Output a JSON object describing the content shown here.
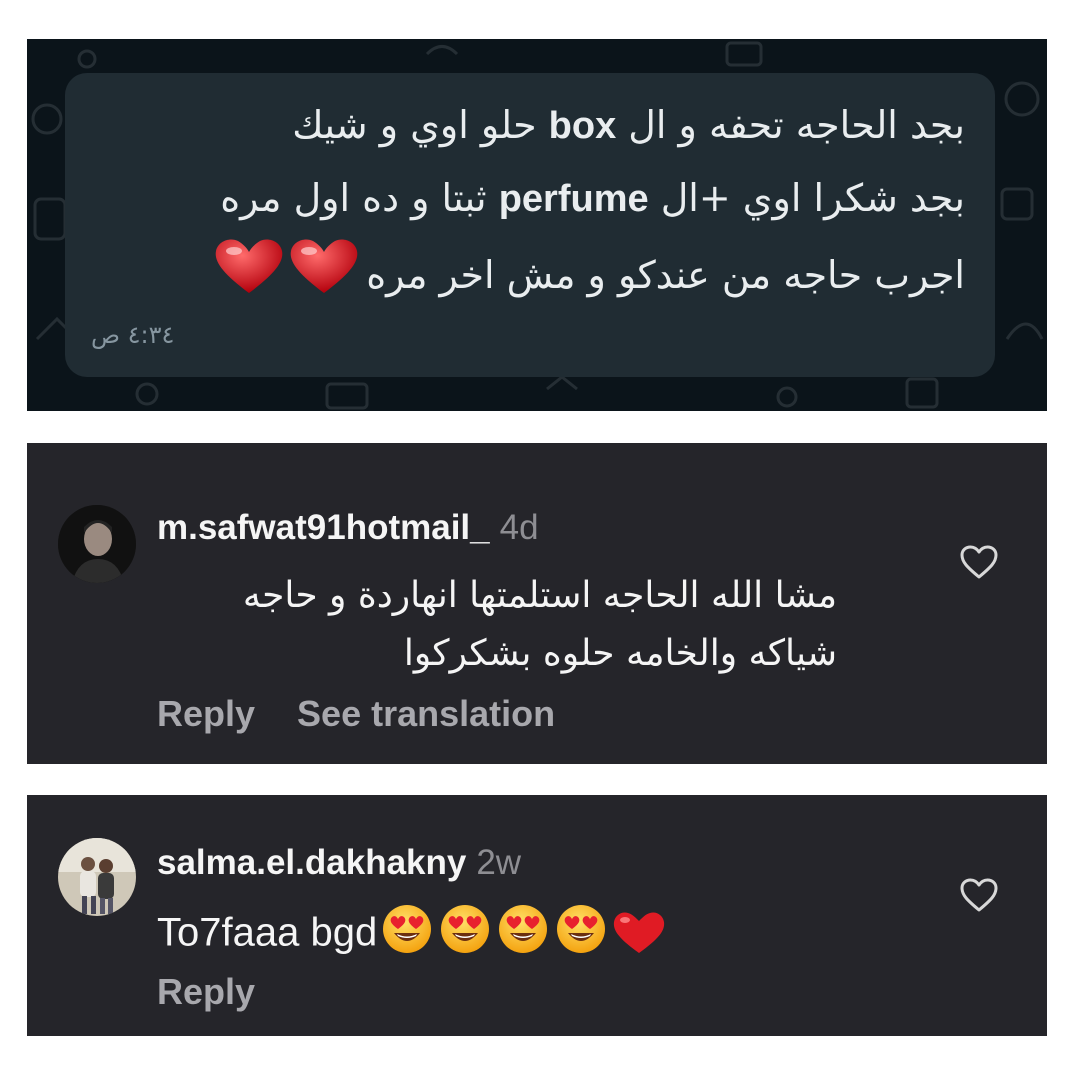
{
  "whatsapp": {
    "message_lines": [
      {
        "pre": "بجد الحاجه تحفه و ال ",
        "latin": "box",
        "post": " حلو اوي و شيك"
      },
      {
        "pre": "بجد شكرا اوي +ال ",
        "latin": "perfume",
        "post": " ثبتا و ده اول مره"
      },
      {
        "pre": "اجرب حاجه من عندكو و مش اخر مره",
        "latin": "",
        "post": ""
      }
    ],
    "heart_emojis": [
      "heart",
      "heart"
    ],
    "time": "٤:٣٤ ص"
  },
  "comments": [
    {
      "username": "m.safwat91hotmail_",
      "age": "4d",
      "text": "مشا الله الحاجه استلمتها انهاردة و حاجه شياكه والخامه حلوه بشكركوا",
      "actions": [
        "Reply",
        "See translation"
      ]
    },
    {
      "username": "salma.el.dakhakny",
      "age": "2w",
      "text": "To7faaa bgd",
      "emojis": [
        "heart-eyes",
        "heart-eyes",
        "heart-eyes",
        "heart-eyes",
        "red-heart"
      ],
      "actions": [
        "Reply"
      ]
    }
  ],
  "colors": {
    "whatsapp_bg": "#0b141a",
    "bubble": "#202c33",
    "comment_bg": "#25252a",
    "username": "#f5f5f5",
    "muted": "#8e8e93"
  }
}
